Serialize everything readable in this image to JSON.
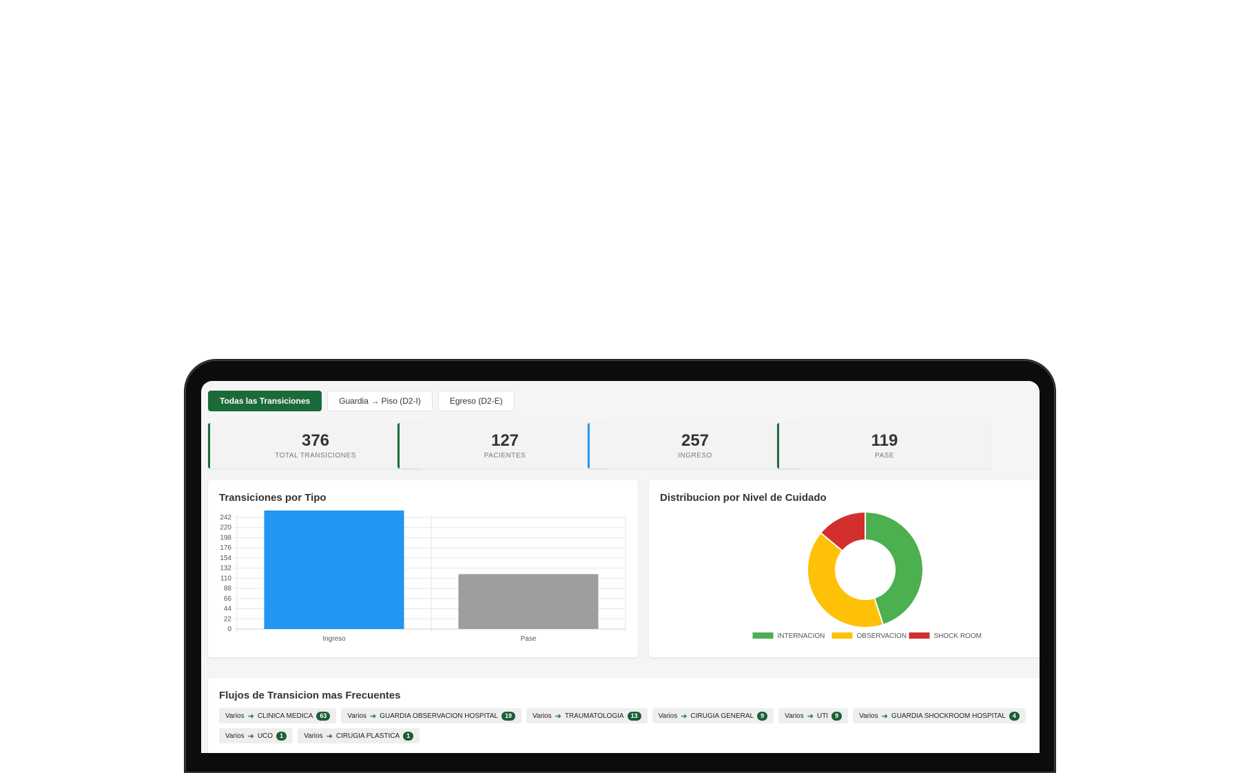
{
  "tabs": [
    {
      "label": "Todas las Transiciones",
      "active": true
    },
    {
      "label": "Guardia → Piso (D2-I)",
      "active": false
    },
    {
      "label": "Egreso (D2-E)",
      "active": false
    }
  ],
  "stats": [
    {
      "value": "376",
      "label": "TOTAL TRANSICIONES",
      "accent": "#1b6b3a"
    },
    {
      "value": "127",
      "label": "PACIENTES",
      "accent": "#1b6b3a"
    },
    {
      "value": "257",
      "label": "INGRESO",
      "accent": "#2196f3"
    },
    {
      "value": "119",
      "label": "PASE",
      "accent": "#1b6b3a"
    }
  ],
  "bar_card": {
    "title": "Transiciones por Tipo"
  },
  "donut_card": {
    "title": "Distribucion por Nivel de Cuidado"
  },
  "flow_card": {
    "title": "Flujos de Transicion mas Frecuentes",
    "flows": [
      {
        "from": "Varios",
        "to": "CLINICA MEDICA",
        "count": "63"
      },
      {
        "from": "Varios",
        "to": "GUARDIA OBSERVACION HOSPITAL",
        "count": "19"
      },
      {
        "from": "Varios",
        "to": "TRAUMATOLOGIA",
        "count": "13"
      },
      {
        "from": "Varios",
        "to": "CIRUGIA GENERAL",
        "count": "9"
      },
      {
        "from": "Varios",
        "to": "UTI",
        "count": "9"
      },
      {
        "from": "Varios",
        "to": "GUARDIA SHOCKROOM HOSPITAL",
        "count": "4"
      },
      {
        "from": "Varios",
        "to": "UCO",
        "count": "1"
      },
      {
        "from": "Varios",
        "to": "CIRUGIA PLASTICA",
        "count": "1"
      }
    ]
  },
  "chart_data": [
    {
      "type": "bar",
      "title": "Transiciones por Tipo",
      "categories": [
        "Ingreso",
        "Pase"
      ],
      "values": [
        257,
        119
      ],
      "colors": [
        "#2196f3",
        "#9e9e9e"
      ],
      "yticks": [
        0,
        22,
        44,
        66,
        88,
        110,
        132,
        154,
        176,
        198,
        220,
        242
      ],
      "ylim": [
        0,
        242
      ],
      "grid": true
    },
    {
      "type": "pie",
      "title": "Distribucion por Nivel de Cuidado",
      "labels": [
        "INTERNACION",
        "OBSERVACION",
        "SHOCK ROOM"
      ],
      "values": [
        45,
        41,
        14
      ],
      "colors": [
        "#4caf50",
        "#ffc107",
        "#d32f2f"
      ],
      "legend_position": "bottom"
    }
  ]
}
